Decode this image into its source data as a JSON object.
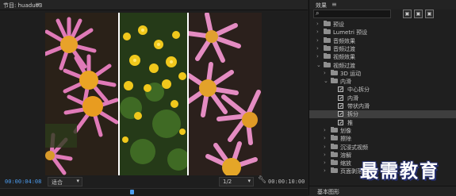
{
  "monitor": {
    "title": "节目: huaduo3",
    "timecode_current": "00:00:04:08",
    "fit_value": "适合",
    "resolution_value": "1/2",
    "timecode_total": "00:00:10:00"
  },
  "effects": {
    "title": "效果",
    "tree": [
      {
        "label": "预设",
        "level": 0,
        "type": "folder",
        "expanded": false
      },
      {
        "label": "Lumetri 预设",
        "level": 0,
        "type": "folder",
        "expanded": false
      },
      {
        "label": "音频效果",
        "level": 0,
        "type": "folder",
        "expanded": false
      },
      {
        "label": "音频过渡",
        "level": 0,
        "type": "folder",
        "expanded": false
      },
      {
        "label": "视频效果",
        "level": 0,
        "type": "folder",
        "expanded": false
      },
      {
        "label": "视频过渡",
        "level": 0,
        "type": "folder",
        "expanded": true
      },
      {
        "label": "3D 运动",
        "level": 1,
        "type": "folder",
        "expanded": false
      },
      {
        "label": "内滑",
        "level": 1,
        "type": "folder",
        "expanded": true
      },
      {
        "label": "中心拆分",
        "level": 2,
        "type": "effect"
      },
      {
        "label": "内滑",
        "level": 2,
        "type": "effect"
      },
      {
        "label": "带状内滑",
        "level": 2,
        "type": "effect"
      },
      {
        "label": "拆分",
        "level": 2,
        "type": "effect",
        "selected": true
      },
      {
        "label": "推",
        "level": 2,
        "type": "effect"
      },
      {
        "label": "划像",
        "level": 1,
        "type": "folder",
        "expanded": false
      },
      {
        "label": "擦除",
        "level": 1,
        "type": "folder",
        "expanded": false
      },
      {
        "label": "沉浸式视频",
        "level": 1,
        "type": "folder",
        "expanded": false
      },
      {
        "label": "溶解",
        "level": 1,
        "type": "folder",
        "expanded": false
      },
      {
        "label": "缩放",
        "level": 1,
        "type": "folder",
        "expanded": false
      },
      {
        "label": "页面剥落",
        "level": 1,
        "type": "folder",
        "expanded": false
      }
    ],
    "footer_label": "基本图形"
  },
  "watermark": "最需教育",
  "colors": {
    "accent": "#4c9df0",
    "panel_bg": "#1f1f1f",
    "selected_row": "#3e3e3e"
  }
}
